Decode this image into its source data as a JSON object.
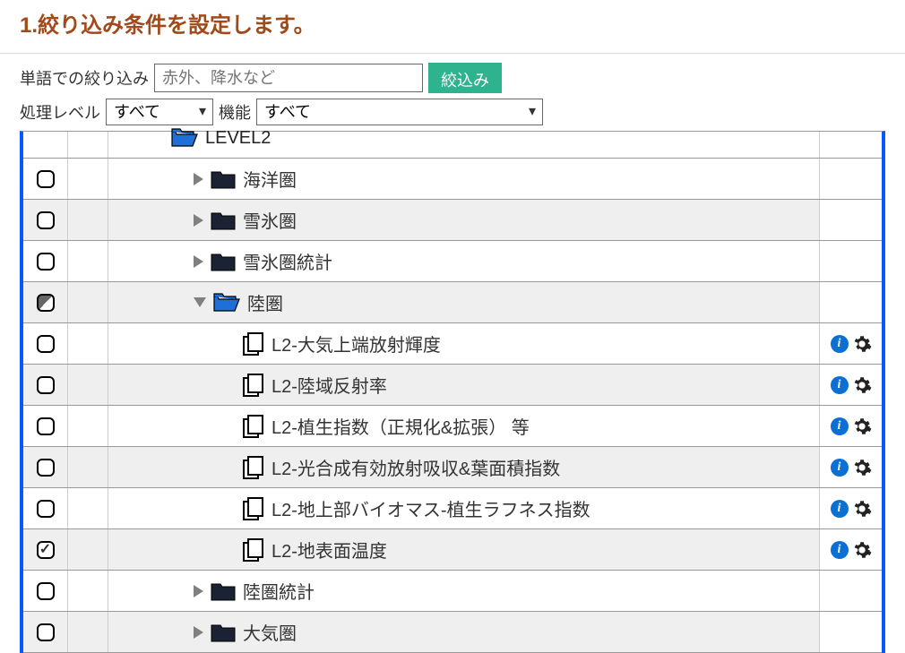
{
  "page_title": "1.絞り込み条件を設定します。",
  "filter": {
    "word_label": "単語での絞り込み",
    "placeholder": "赤外、降水など",
    "button": "絞込み",
    "level_label": "処理レベル",
    "level_value": "すべて",
    "feature_label": "機能",
    "feature_value": "すべて"
  },
  "tree": {
    "header_label": "LEVEL2",
    "rows": [
      {
        "label": "海洋圏",
        "type": "folder",
        "expanded": false,
        "indent": 2,
        "shaded": false,
        "check": "off",
        "actions": false
      },
      {
        "label": "雪氷圏",
        "type": "folder",
        "expanded": false,
        "indent": 2,
        "shaded": true,
        "check": "off",
        "actions": false
      },
      {
        "label": "雪氷圏統計",
        "type": "folder",
        "expanded": false,
        "indent": 2,
        "shaded": false,
        "check": "off",
        "actions": false
      },
      {
        "label": "陸圏",
        "type": "folder-open",
        "expanded": true,
        "indent": 2,
        "shaded": true,
        "check": "partial",
        "actions": false
      },
      {
        "label": "L2-大気上端放射輝度",
        "type": "file",
        "indent": 3,
        "shaded": false,
        "check": "off",
        "actions": true
      },
      {
        "label": "L2-陸域反射率",
        "type": "file",
        "indent": 3,
        "shaded": true,
        "check": "off",
        "actions": true
      },
      {
        "label": "L2-植生指数（正規化&拡張） 等",
        "type": "file",
        "indent": 3,
        "shaded": false,
        "check": "off",
        "actions": true
      },
      {
        "label": "L2-光合成有効放射吸収&葉面積指数",
        "type": "file",
        "indent": 3,
        "shaded": true,
        "check": "off",
        "actions": true
      },
      {
        "label": "L2-地上部バイオマス-植生ラフネス指数",
        "type": "file",
        "indent": 3,
        "shaded": false,
        "check": "off",
        "actions": true
      },
      {
        "label": "L2-地表面温度",
        "type": "file",
        "indent": 3,
        "shaded": true,
        "check": "checked",
        "actions": true
      },
      {
        "label": "陸圏統計",
        "type": "folder",
        "expanded": false,
        "indent": 2,
        "shaded": false,
        "check": "off",
        "actions": false
      },
      {
        "label": "大気圏",
        "type": "folder",
        "expanded": false,
        "indent": 2,
        "shaded": true,
        "check": "off",
        "actions": false
      }
    ]
  }
}
